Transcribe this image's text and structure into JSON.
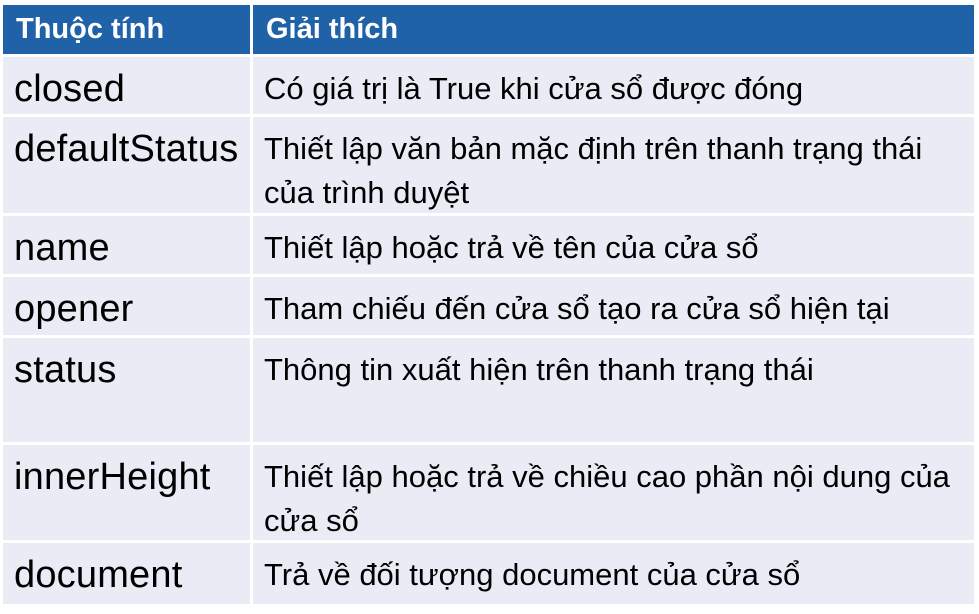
{
  "table": {
    "headers": [
      "Thuộc tính",
      "Giải thích"
    ],
    "header_color": "#1f62a8",
    "row_color": "#e9ebf5",
    "rows": [
      {
        "property": "closed",
        "description": "Có giá trị là True khi cửa sổ được đóng"
      },
      {
        "property": "defaultStatus",
        "description": "Thiết lập văn bản mặc định trên thanh trạng thái của trình duyệt"
      },
      {
        "property": "name",
        "description": "Thiết lập hoặc trả về tên của cửa sổ"
      },
      {
        "property": "opener",
        "description": "Tham chiếu đến cửa sổ tạo ra cửa sổ hiện tại"
      },
      {
        "property": "status",
        "description": "Thông tin xuất hiện trên thanh trạng thái"
      },
      {
        "property": "innerHeight",
        "description": "Thiết lập hoặc trả về chiều cao phần nội dung của cửa sổ"
      },
      {
        "property": "document",
        "description": "Trả về đối tượng document của cửa sổ"
      }
    ]
  }
}
